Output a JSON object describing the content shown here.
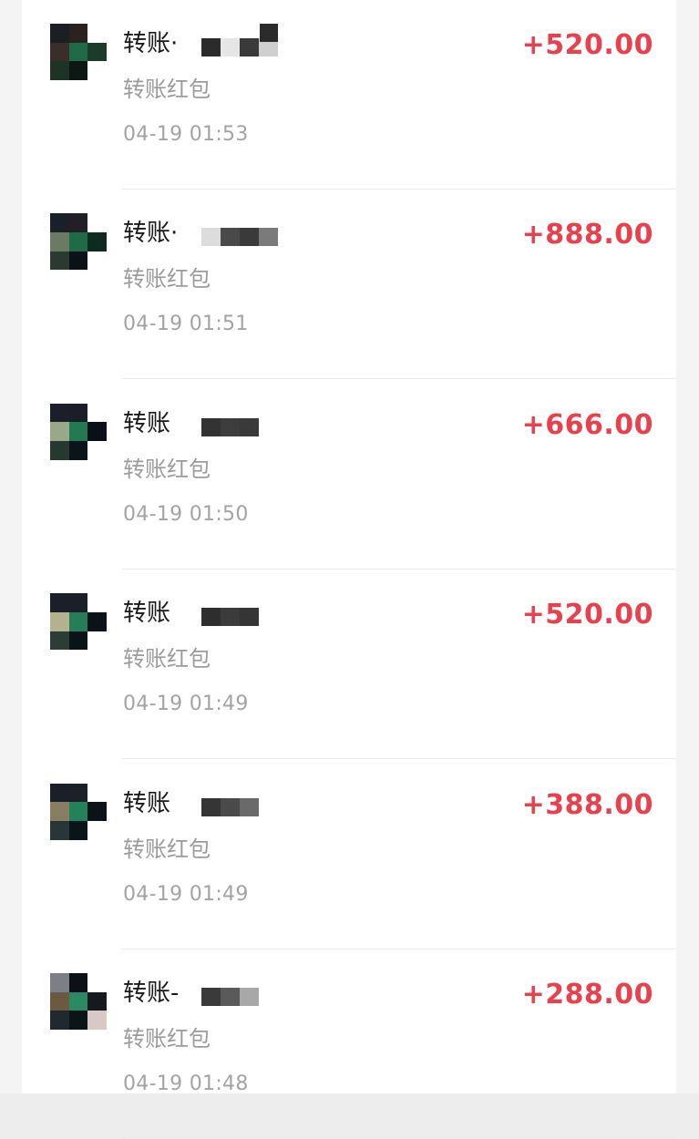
{
  "transactions": [
    {
      "title": "转账·",
      "subtitle": "转账红包",
      "time": "04-19 01:53",
      "amount": "+520.00",
      "avatar_colors": [
        "#1b1f24",
        "#2a221e",
        "#ffffff",
        "#3b2d29",
        "#1f6b47",
        "#1d3b2b",
        "#1c3326",
        "#0d1713",
        "#ffffff"
      ],
      "mosaic_colors": [
        "#2b2b2b",
        "#e6e6e6",
        "#3a3a3a",
        "#cfcfcf"
      ]
    },
    {
      "title": "转账·",
      "subtitle": "转账红包",
      "time": "04-19 01:51",
      "amount": "+888.00",
      "avatar_colors": [
        "#1b1f2a",
        "#231f26",
        "#ffffff",
        "#6b7a62",
        "#1f6b47",
        "#0f2a1e",
        "#2b3a30",
        "#0a1217",
        "#ffffff"
      ],
      "mosaic_colors": [
        "#dcdcdc",
        "#4a4a4a",
        "#3a3a3a",
        "#7a7a7a"
      ]
    },
    {
      "title": "转账",
      "subtitle": "转账红包",
      "time": "04-19 01:50",
      "amount": "+666.00",
      "avatar_colors": [
        "#1a1f2b",
        "#1a1e28",
        "#ffffff",
        "#9aa88a",
        "#237a52",
        "#0a1018",
        "#26392e",
        "#0b1419",
        "#ffffff"
      ],
      "mosaic_colors": [
        "#333333",
        "#3d3d3d",
        "#3a3a3a"
      ]
    },
    {
      "title": "转账",
      "subtitle": "转账红包",
      "time": "04-19 01:49",
      "amount": "+520.00",
      "avatar_colors": [
        "#1a1f29",
        "#1b1f27",
        "#ffffff",
        "#b4b28e",
        "#257e57",
        "#0b1218",
        "#2c3d36",
        "#0a1318",
        "#ffffff"
      ],
      "mosaic_colors": [
        "#2e2e2e",
        "#3b3b3b",
        "#353535"
      ]
    },
    {
      "title": "转账",
      "subtitle": "转账红包",
      "time": "04-19 01:49",
      "amount": "+388.00",
      "avatar_colors": [
        "#1a1f29",
        "#1c2028",
        "#ffffff",
        "#8a7e62",
        "#23825a",
        "#0b1318",
        "#293637",
        "#0b1419",
        "#ffffff"
      ],
      "mosaic_colors": [
        "#353535",
        "#4a4a4a",
        "#6a6a6a"
      ]
    },
    {
      "title": "转账-",
      "subtitle": "转账红包",
      "time": "04-19 01:48",
      "amount": "+288.00",
      "avatar_colors": [
        "#7d7f86",
        "#0d1117",
        "#ffffff",
        "#6b5a40",
        "#2a8a62",
        "#161a1e",
        "#1e2a30",
        "#0d1418",
        "#d8c8c6"
      ],
      "mosaic_colors": [
        "#3a3a3a",
        "#5a5a5a",
        "#a8a8a8"
      ]
    }
  ]
}
